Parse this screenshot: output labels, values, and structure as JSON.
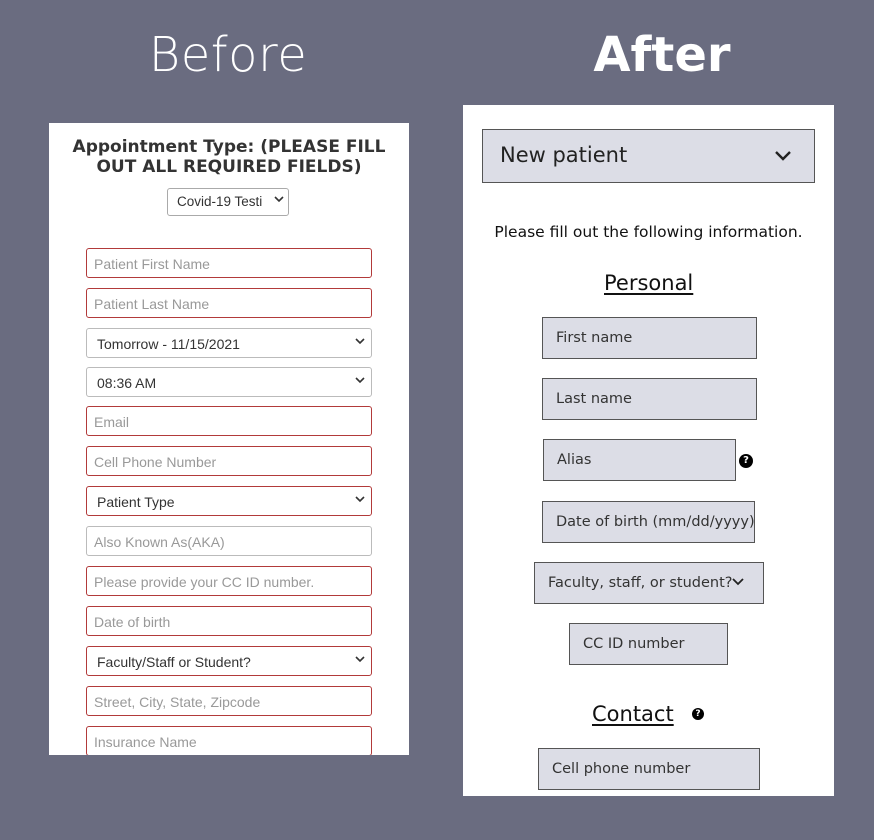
{
  "headings": {
    "before": "Before",
    "after": "After"
  },
  "before": {
    "title": "Appointment Type: (PLEASE FILL OUT ALL REQUIRED FIELDS)",
    "appointment_type": "Covid-19 Testi",
    "fields": [
      {
        "label": "Patient First Name"
      },
      {
        "label": "Patient Last Name"
      },
      {
        "label": "Tomorrow - 11/15/2021"
      },
      {
        "label": "08:36 AM"
      },
      {
        "label": "Email"
      },
      {
        "label": "Cell Phone Number"
      },
      {
        "label": "Patient Type"
      },
      {
        "label": "Also Known As(AKA)"
      },
      {
        "label": "Please provide your CC ID number."
      },
      {
        "label": "Date of birth"
      },
      {
        "label": "Faculty/Staff or Student?"
      },
      {
        "label": "Street, City, State, Zipcode"
      },
      {
        "label": "Insurance Name"
      }
    ]
  },
  "after": {
    "patient_type": "New patient",
    "intro": "Please fill out the following information.",
    "personal_heading": "Personal",
    "first_name": "First name",
    "last_name": "Last name",
    "alias": "Alias",
    "dob": "Date of birth (mm/dd/yyyy)",
    "role": "Faculty, staff, or student?",
    "cc_id": "CC ID number",
    "contact_heading": "Contact",
    "cell_phone": "Cell phone number",
    "help_glyph": "?"
  }
}
